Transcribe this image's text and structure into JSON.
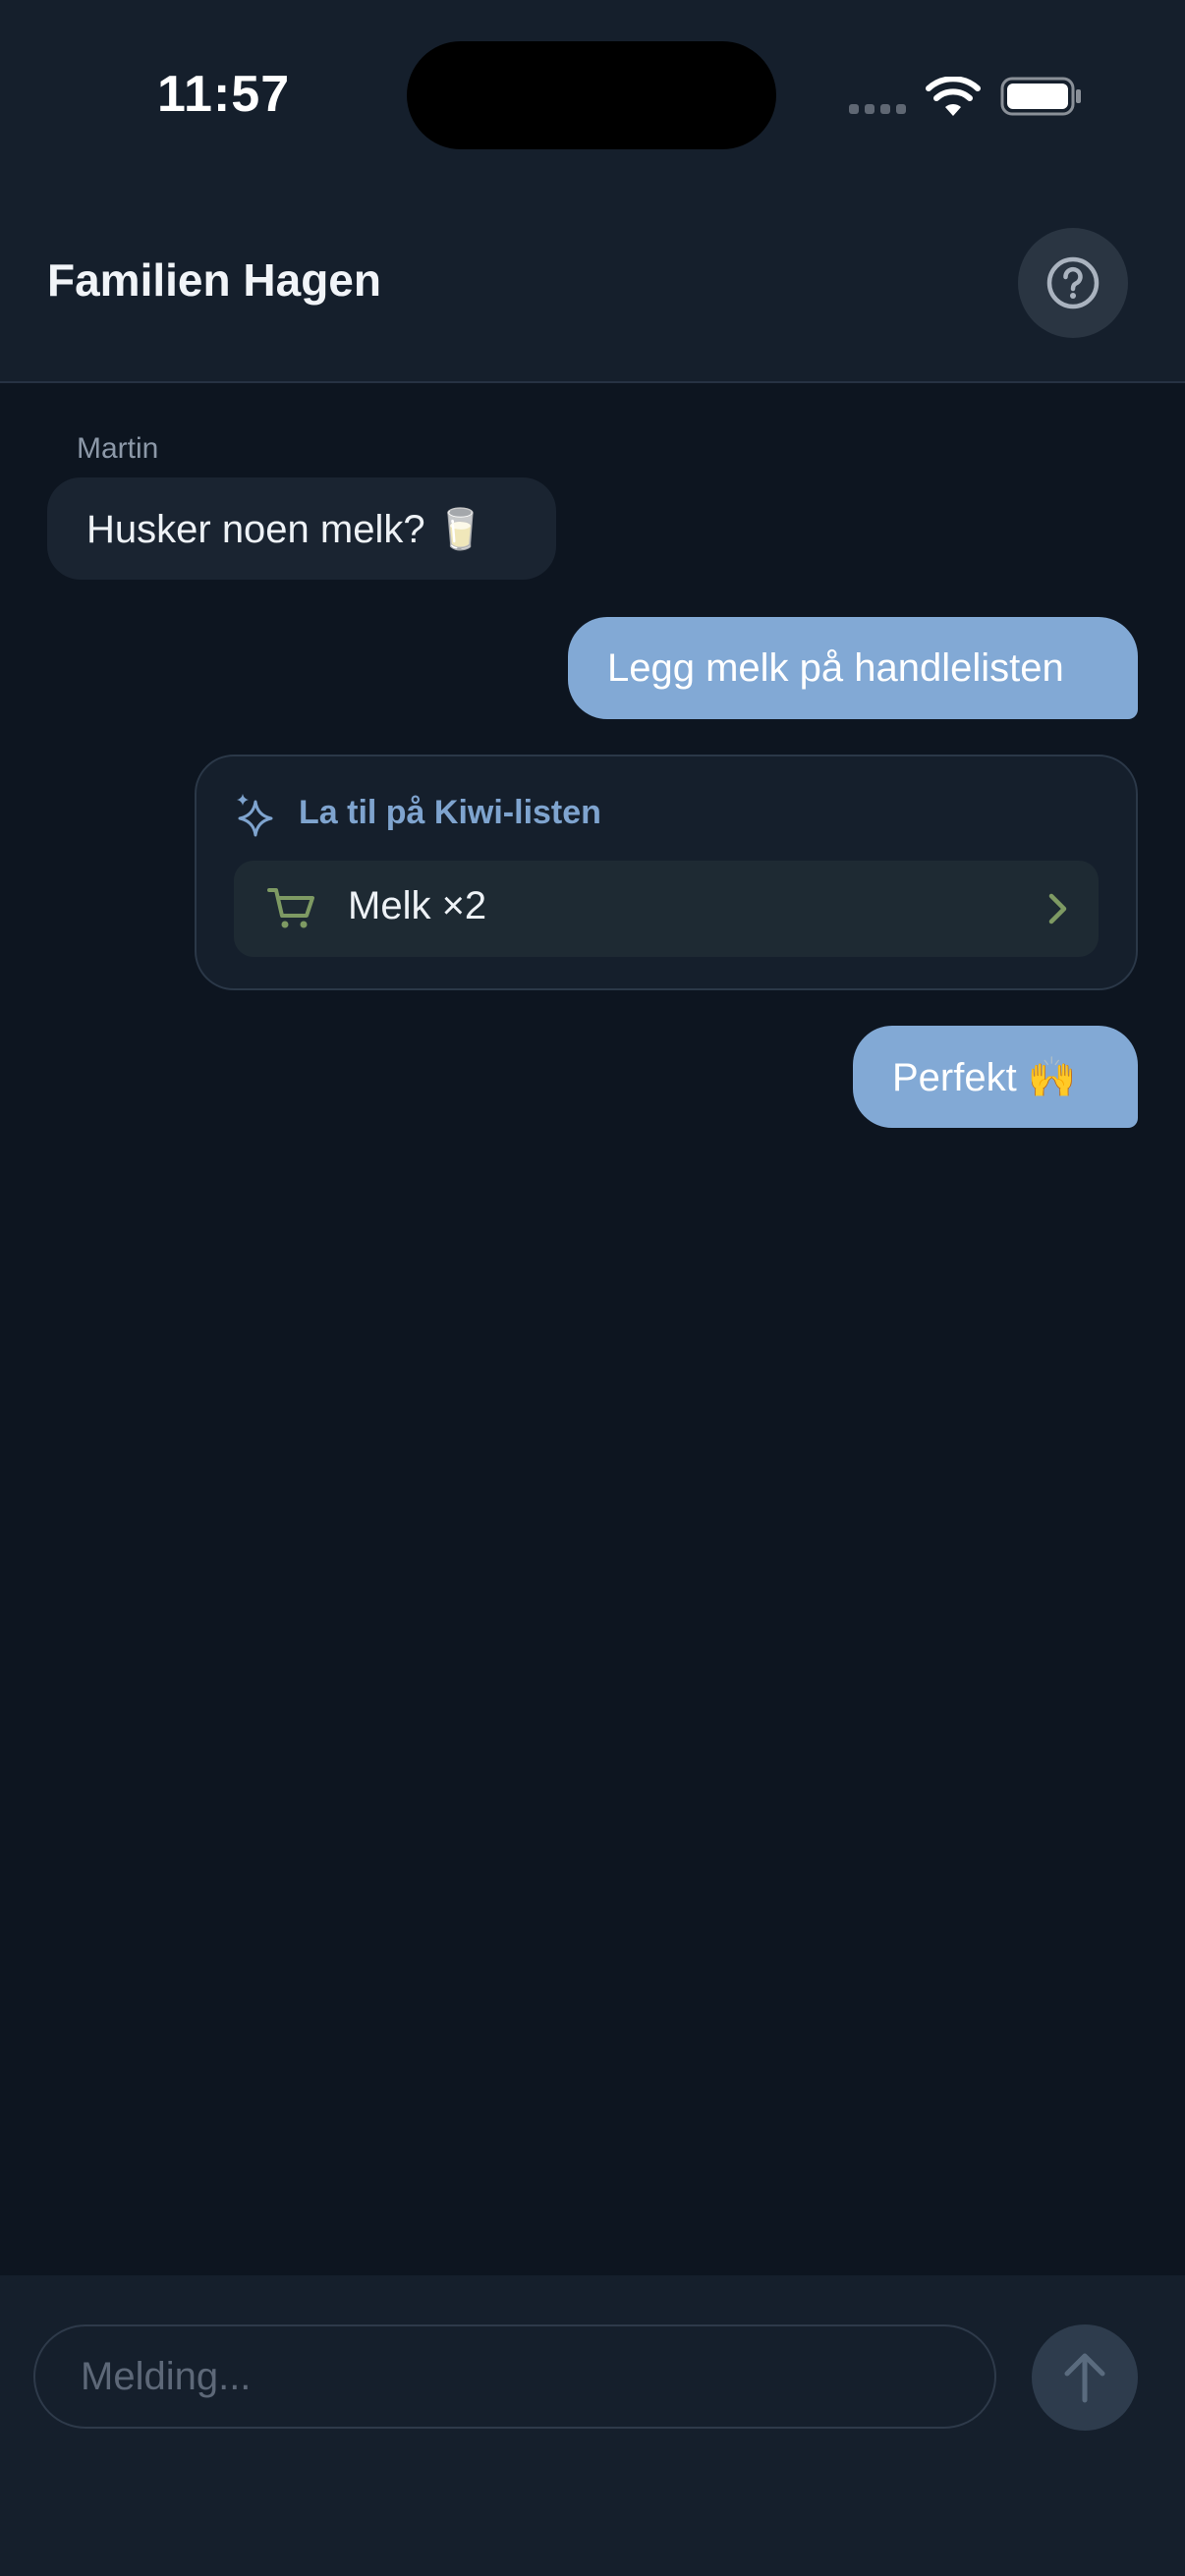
{
  "status_bar": {
    "time": "11:57"
  },
  "header": {
    "title": "Familien Hagen",
    "help_icon": "question-circle-icon"
  },
  "messages": [
    {
      "sender": "Martin",
      "text": "Husker noen melk? 🥛",
      "direction": "incoming"
    },
    {
      "text": "Legg melk på handlelisten",
      "direction": "outgoing"
    },
    {
      "text": "Perfekt 🙌",
      "direction": "outgoing"
    }
  ],
  "action_card": {
    "icon": "sparkle-icon",
    "title": "La til på Kiwi-listen",
    "item": {
      "icon": "cart-icon",
      "label": "Melk ×2"
    }
  },
  "composer": {
    "placeholder": "Melding...",
    "value": "",
    "send_icon": "arrow-up-icon"
  },
  "colors": {
    "accent": "#82a9d5",
    "card_title": "#7fa4cf",
    "cart_green": "#7e9a63",
    "background": "#0d1520",
    "surface": "#151f2c"
  }
}
